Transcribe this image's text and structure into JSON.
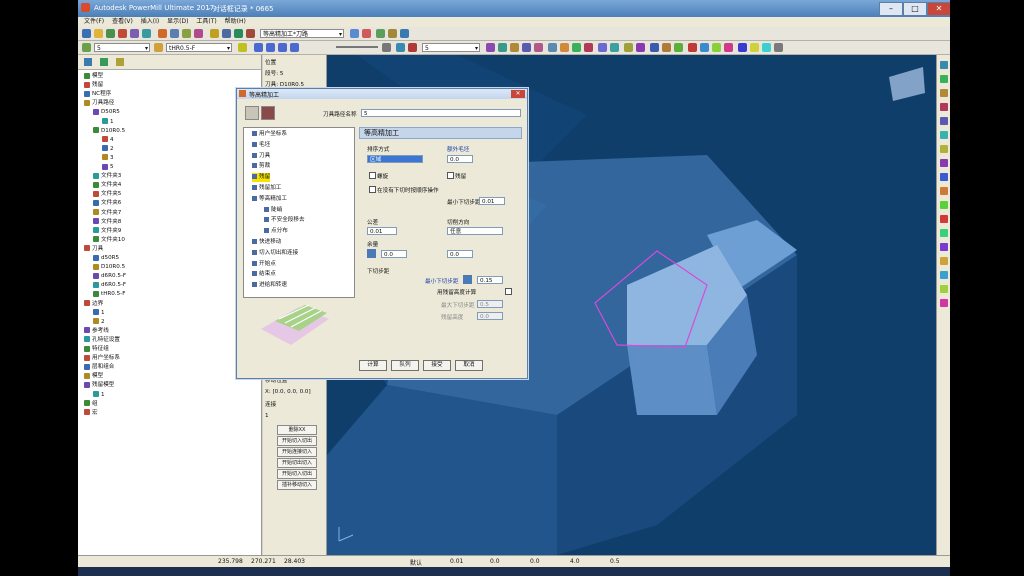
{
  "window": {
    "title": "Autodesk PowerMill Ultimate 2017",
    "doc": "- 对话框记录 * 0665"
  },
  "menu": [
    "文件(F)",
    "查看(V)",
    "插入(I)",
    "显示(D)",
    "工具(T)",
    "帮助(H)"
  ],
  "toolbar": {
    "toolpath_combo": "等高精加工*刀路",
    "layer_combo": "5",
    "tool_combo": "tHR0.5-F",
    "level_combo": "5"
  },
  "explorer": {
    "items": [
      {
        "label": "模型",
        "indent": 0
      },
      {
        "label": "残留",
        "indent": 0
      },
      {
        "label": "NC程序",
        "indent": 0
      },
      {
        "label": "刀具路径",
        "indent": 0
      },
      {
        "label": "D50R5",
        "indent": 1
      },
      {
        "label": "1",
        "indent": 2
      },
      {
        "label": "D10R0.5",
        "indent": 1
      },
      {
        "label": "4",
        "indent": 2
      },
      {
        "label": "2",
        "indent": 2
      },
      {
        "label": "3",
        "indent": 2
      },
      {
        "label": "5",
        "indent": 2
      },
      {
        "label": "文件夹3",
        "indent": 1
      },
      {
        "label": "文件夹4",
        "indent": 1
      },
      {
        "label": "文件夹5",
        "indent": 1
      },
      {
        "label": "文件夹6",
        "indent": 1
      },
      {
        "label": "文件夹7",
        "indent": 1
      },
      {
        "label": "文件夹8",
        "indent": 1
      },
      {
        "label": "文件夹9",
        "indent": 1
      },
      {
        "label": "文件夹10",
        "indent": 1
      },
      {
        "label": "刀具",
        "indent": 0
      },
      {
        "label": "d50R5",
        "indent": 1
      },
      {
        "label": "D10R0.5",
        "indent": 1
      },
      {
        "label": "d6R0.5-F",
        "indent": 1
      },
      {
        "label": "d6R0.5-F",
        "indent": 1
      },
      {
        "label": "tHR0.5-F",
        "indent": 1
      },
      {
        "label": "边界",
        "indent": 0
      },
      {
        "label": "1",
        "indent": 1
      },
      {
        "label": "2",
        "indent": 1
      },
      {
        "label": "参考线",
        "indent": 0
      },
      {
        "label": "孔特征设置",
        "indent": 0
      },
      {
        "label": "特征组",
        "indent": 0
      },
      {
        "label": "用户坐标系",
        "indent": 0
      },
      {
        "label": "层和组合",
        "indent": 0
      },
      {
        "label": "模型",
        "indent": 0
      },
      {
        "label": "残留模型",
        "indent": 0
      },
      {
        "label": "1",
        "indent": 1
      },
      {
        "label": "组",
        "indent": 0
      },
      {
        "label": "宏",
        "indent": 0
      }
    ]
  },
  "sidepanel": {
    "top_rows": [
      "位置",
      "段号: 5",
      "刀具: D10R0.5"
    ],
    "bottom_rows": [
      "移动位置",
      "X: [0.0, 0.0, 0.0]",
      "连接",
      "1"
    ],
    "buttons": [
      "删除XX",
      "开始切入切出",
      "开始连接切入",
      "开始切出切入",
      "开始切入切出",
      "插补移动切入"
    ]
  },
  "dialog": {
    "title": "等高精加工",
    "name_label": "刀具路径名称",
    "name_value": "5",
    "tree": [
      "用户坐标系",
      "毛坯",
      "刀具",
      "剪裁",
      "残留",
      "残留加工",
      "等高精加工",
      "陡峭",
      "不安全段移去",
      "点分布",
      "快进移动",
      "切入切出和连接",
      "开始点",
      "结束点",
      "进给和转速"
    ],
    "header": "等高精加工",
    "sort_label": "排序方式",
    "sort_value": "区域",
    "extra_label": "额外毛坯",
    "extra_value": "0.0",
    "check_spiral": "螺旋",
    "check_finish": "残留",
    "check_tapered": "在没有下切时按顺序操作",
    "min_step_label": "最小下切步距",
    "min_step_value": "0.01",
    "tolerance_label": "公差",
    "tolerance_value": "0.01",
    "cut_direction_label": "切削方向",
    "cut_direction_value": "任意",
    "allowance_label": "余量",
    "allowance_value": "0.0",
    "allowance2_value": "0.0",
    "stepdown_section": "下切步距",
    "stepdown_label": "最小下切步距",
    "stepdown_value": "0.15",
    "use_residual_label": "用残留高度计算",
    "residual_label1": "最大下切步距",
    "residual_value1": "0.5",
    "residual_label2": "残留高度",
    "residual_value2": "0.0",
    "buttons": [
      "计算",
      "队列",
      "接受",
      "取消"
    ]
  },
  "status": {
    "coords": [
      "235.798",
      "270.271",
      "28.403"
    ],
    "items": [
      "默认",
      "0.01",
      "0.0",
      "0.0",
      "4.0",
      "0.5"
    ]
  },
  "viewport": {
    "background": "#0f3e6b",
    "part_color": "#5a8fc8"
  }
}
